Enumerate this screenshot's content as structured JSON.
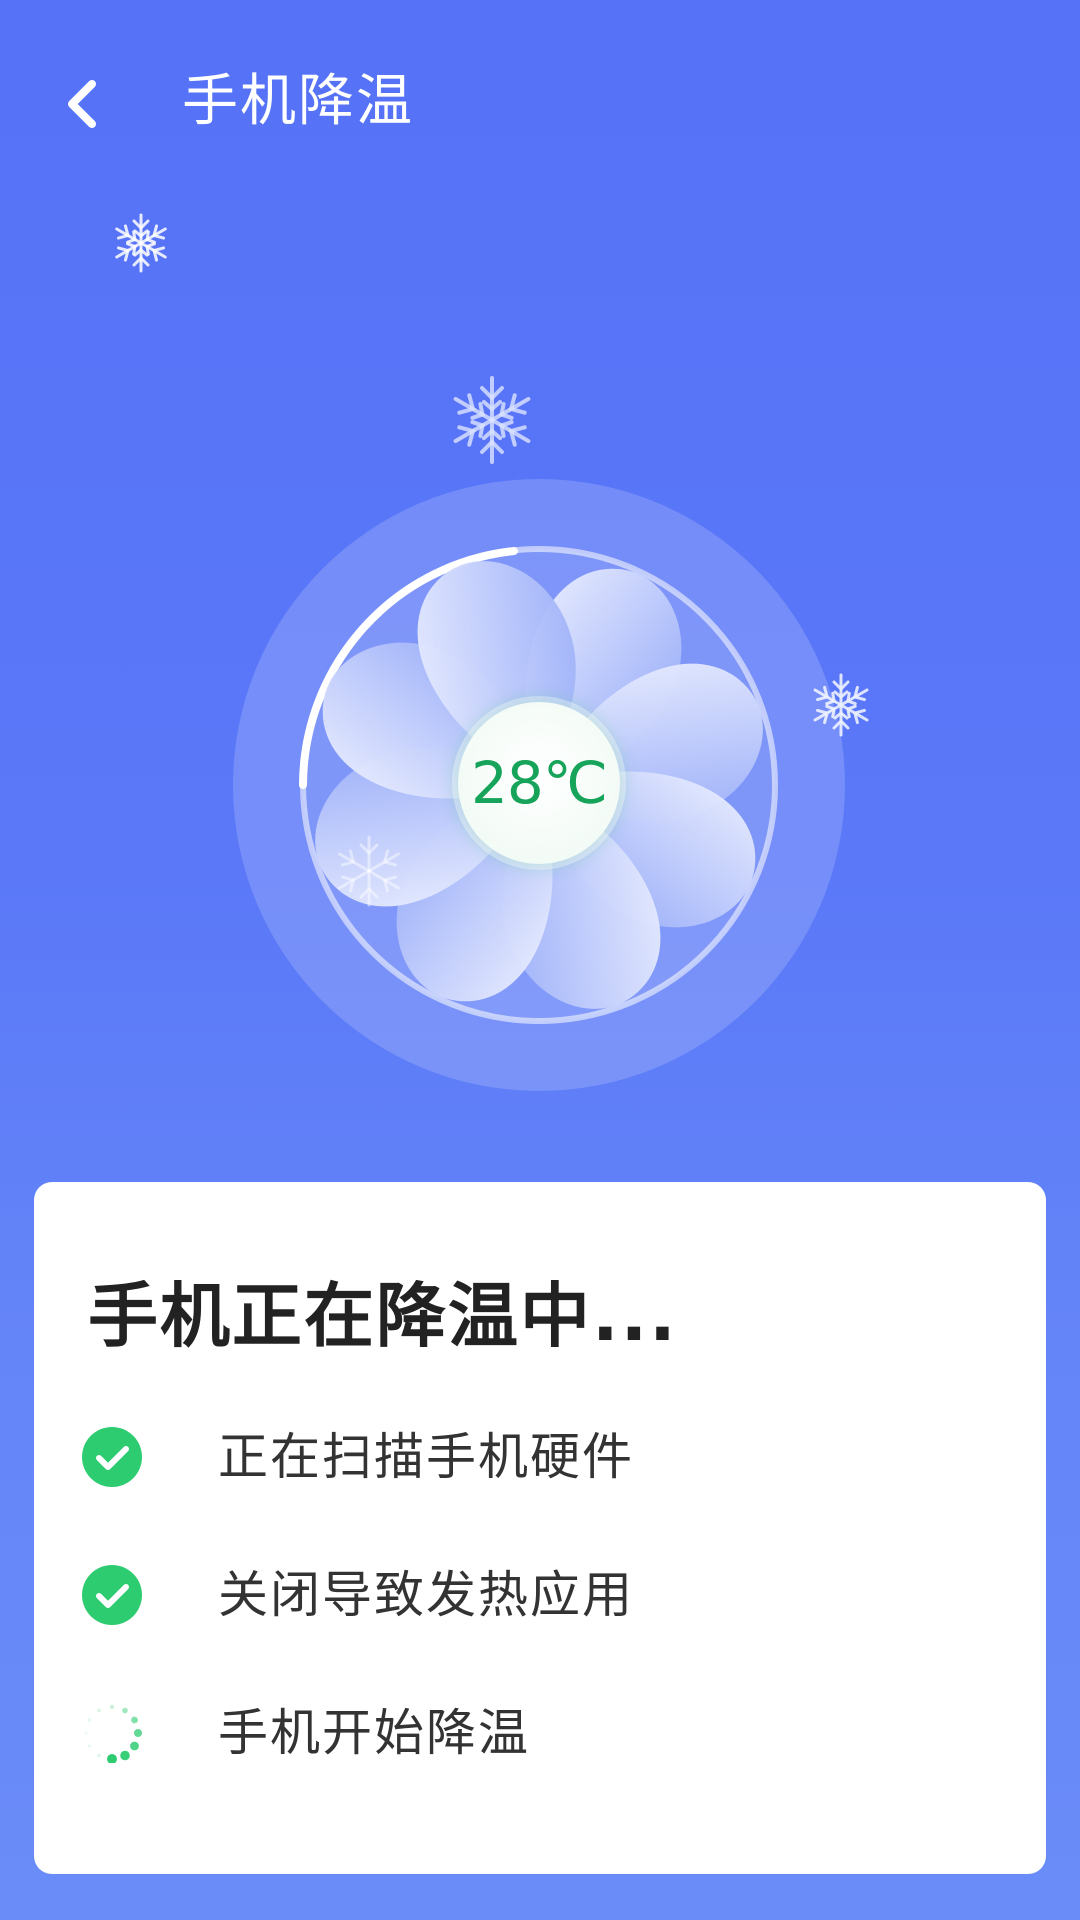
{
  "header": {
    "title": "手机降温",
    "back_icon": "chevron-left-icon"
  },
  "fan": {
    "temperature": "28℃",
    "icon": "fan-icon"
  },
  "colors": {
    "background_top": "#5672f7",
    "background_bottom": "#6a8cf8",
    "check_green": "#2ecc71",
    "temperature_green": "#16a35a",
    "card": "#ffffff"
  },
  "card": {
    "title": "手机正在降温中...",
    "steps": [
      {
        "label": "正在扫描手机硬件",
        "status": "done",
        "icon": "check-circle-icon"
      },
      {
        "label": "关闭导致发热应用",
        "status": "done",
        "icon": "check-circle-icon"
      },
      {
        "label": "手机开始降温",
        "status": "in-progress",
        "icon": "loading-spinner-icon"
      }
    ]
  }
}
